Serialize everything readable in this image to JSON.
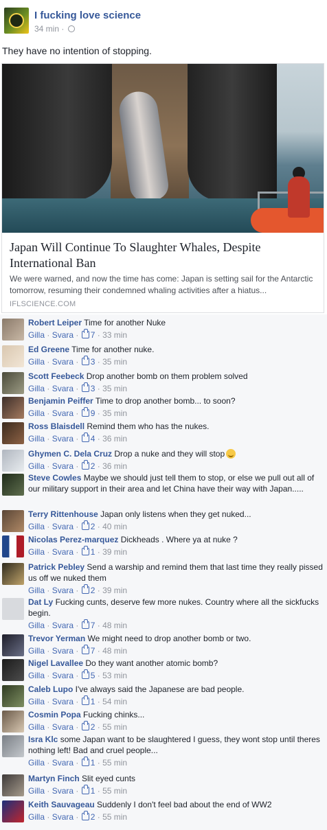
{
  "post": {
    "page_name": "I fucking love science",
    "time": "34 min",
    "separator": "·",
    "audience_icon": "gear-icon",
    "text": "They have no intention of stopping."
  },
  "link": {
    "title": "Japan Will Continue To Slaughter Whales, Despite International Ban",
    "description": "We were warned, and now the time has come: Japan is setting sail for the Antarctic tomorrow, resuming their condemned whaling activities after a hiatus...",
    "domain": "IFLSCIENCE.COM"
  },
  "labels": {
    "like": "Gilla",
    "reply": "Svara",
    "dot": "·"
  },
  "colors": {
    "link_blue": "#365899",
    "action_blue": "#4267b2",
    "meta_gray": "#90949c",
    "comment_bg": "#f6f7f9"
  },
  "comments": [
    {
      "author": "Robert Leiper",
      "text": "Time for another Nuke",
      "likes": "7",
      "time": "33 min"
    },
    {
      "author": "Ed Greene",
      "text": "Time for another nuke.",
      "likes": "3",
      "time": "35 min"
    },
    {
      "author": "Scott Feebeck",
      "text": "Drop another bomb on them problem solved",
      "likes": "3",
      "time": "35 min"
    },
    {
      "author": "Benjamin Peiffer",
      "text": "Time to drop another bomb... to soon?",
      "likes": "9",
      "time": "35 min"
    },
    {
      "author": "Ross Blaisdell",
      "text": "Remind them who has the nukes.",
      "likes": "4",
      "time": "36 min"
    },
    {
      "author": "Ghymen C. Dela Cruz",
      "text": "Drop a nuke and they will stop",
      "likes": "2",
      "time": "36 min"
    },
    {
      "author": "Steve Cowles",
      "text": "Maybe we should just tell them to stop, or else we pull out all of our military support in their area and let China have their way with Japan.....",
      "likes": "",
      "time": ""
    },
    {
      "author": "Terry Rittenhouse",
      "text": "Japan only listens when they get nuked...",
      "likes": "2",
      "time": "40 min"
    },
    {
      "author": "Nicolas Perez-marquez",
      "text": "Dickheads . Where ya at nuke ?",
      "likes": "1",
      "time": "39 min"
    },
    {
      "author": "Patrick Pebley",
      "text": "Send a warship and remind them that last time they really pissed us off we nuked them",
      "likes": "2",
      "time": "39 min"
    },
    {
      "author": "Dat Ly",
      "text": "Fucking cunts, deserve few more nukes. Country where all the sickfucks begin.",
      "likes": "7",
      "time": "48 min"
    },
    {
      "author": "Trevor Yerman",
      "text": "We might need to drop another bomb or two.",
      "likes": "7",
      "time": "48 min"
    },
    {
      "author": "Nigel Lavallee",
      "text": "Do they want another atomic bomb?",
      "likes": "5",
      "time": "53 min"
    },
    {
      "author": "Caleb Lupo",
      "text": "I've always said the Japanese are bad people.",
      "likes": "1",
      "time": "54 min"
    },
    {
      "author": "Cosmin Popa",
      "text": "Fucking chinks...",
      "likes": "2",
      "time": "55 min"
    },
    {
      "author": "Isra Klc",
      "text": "some Japan want to be slaughtered I guess, they wont stop until theres nothing left! Bad and cruel people...",
      "likes": "1",
      "time": "55 min"
    },
    {
      "author": "Martyn Finch",
      "text": "Slit eyed cunts",
      "likes": "1",
      "time": "55 min"
    },
    {
      "author": "Keith Sauvageau",
      "text": "Suddenly I don't feel bad about the end of WW2",
      "likes": "2",
      "time": "55 min"
    }
  ]
}
